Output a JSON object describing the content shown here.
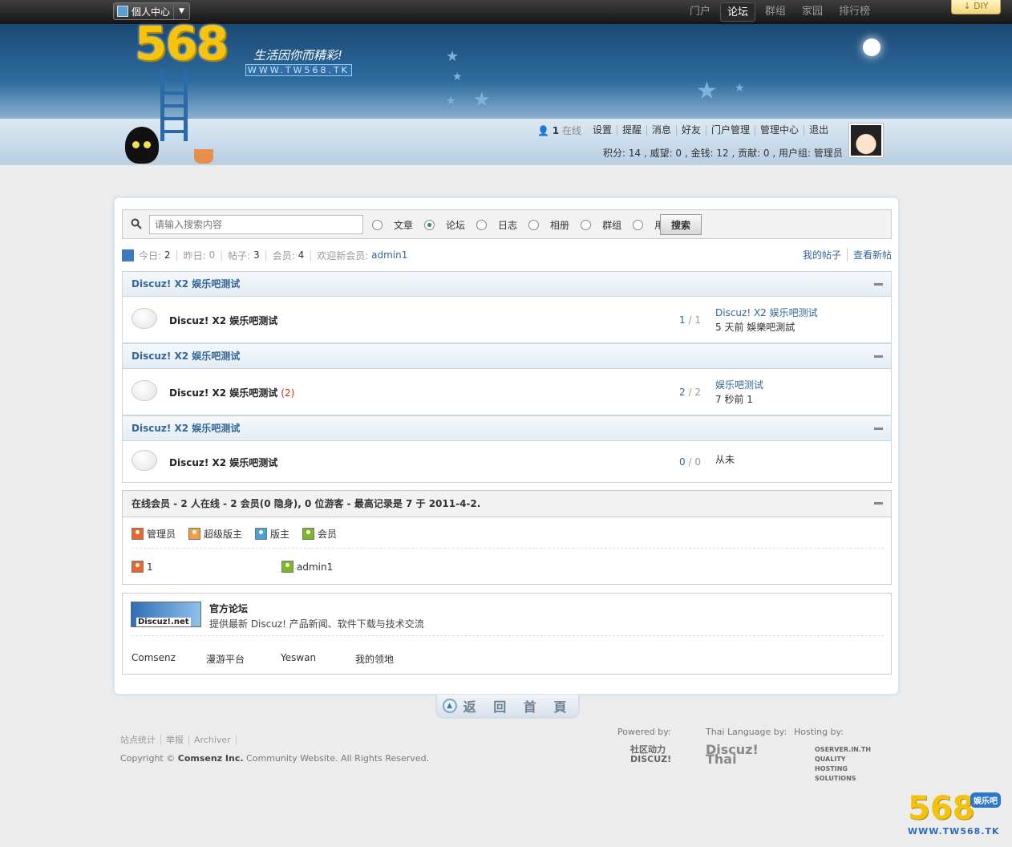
{
  "topbar": {
    "personal_label": "個人中心",
    "nav": [
      {
        "label": "门户",
        "active": false
      },
      {
        "label": "论坛",
        "active": true
      },
      {
        "label": "群组",
        "active": false
      },
      {
        "label": "家园",
        "active": false
      },
      {
        "label": "排行榜",
        "active": false
      }
    ],
    "diy_label": "DIY"
  },
  "header": {
    "logo_text": "568",
    "slogan": "生活因你而精彩!",
    "site_url": "WWW.TW568.TK"
  },
  "user": {
    "online_count": "1",
    "online_label": "在线",
    "menu": [
      "设置",
      "提醒",
      "消息",
      "好友",
      "门户管理",
      "管理中心",
      "退出"
    ],
    "credits": "积分: 14 , 威望: 0 , 金钱: 12 , 贡献: 0 , 用户组: 管理员"
  },
  "search": {
    "placeholder": "请输入搜索内容",
    "options": [
      {
        "label": "文章",
        "checked": false
      },
      {
        "label": "论坛",
        "checked": true
      },
      {
        "label": "日志",
        "checked": false
      },
      {
        "label": "相册",
        "checked": false
      },
      {
        "label": "群组",
        "checked": false
      },
      {
        "label": "用户",
        "checked": false
      }
    ],
    "button_label": "搜索"
  },
  "stats": {
    "today_label": "今日:",
    "today": "2",
    "yesterday_label": "昨日:",
    "yesterday": "0",
    "posts_label": "帖子:",
    "posts": "3",
    "members_label": "会员:",
    "members": "4",
    "newmember_label": "欢迎新会员:",
    "newmember": "admin1",
    "my_posts": "我的帖子",
    "new_posts": "查看新帖"
  },
  "categories": [
    {
      "title": "Discuz! X2 娱乐吧测试",
      "forum": {
        "name": "Discuz! X2 娱乐吧测试",
        "new_count": "",
        "threads": "1",
        "sep": "/",
        "posts": "1",
        "last_title": "Discuz! X2 娱乐吧测试",
        "last_meta": "5 天前  娛樂吧測試"
      }
    },
    {
      "title": "Discuz! X2 娱乐吧测试",
      "forum": {
        "name": "Discuz! X2 娱乐吧测试",
        "new_count": "(2)",
        "threads": "2",
        "sep": "/",
        "posts": "2",
        "last_title": "娱乐吧测试",
        "last_meta": "7 秒前  1"
      }
    },
    {
      "title": "Discuz! X2 娱乐吧测试",
      "forum": {
        "name": "Discuz! X2 娱乐吧测试",
        "new_count": "",
        "threads": "0",
        "sep": "/",
        "posts": "0",
        "last_title": "",
        "last_meta": "从未"
      }
    }
  ],
  "online": {
    "title": "在线会员  - 2 人在线  - 2 会员(0 隐身), 0 位游客  - 最高记录是  7 于  2011-4-2.",
    "legend": [
      {
        "label": "管理员",
        "color": "#e8682a"
      },
      {
        "label": "超级版主",
        "color": "#f0a040"
      },
      {
        "label": "版主",
        "color": "#4aa0d8"
      },
      {
        "label": "会员",
        "color": "#7ab828"
      }
    ],
    "users": [
      {
        "name": "1",
        "color": "#e8682a"
      },
      {
        "name": "admin1",
        "color": "#7ab828"
      }
    ]
  },
  "links": {
    "logo_text": "Discuz!.net",
    "title": "官方论坛",
    "desc": "提供最新  Discuz! 产品新闻、软件下载与技术交流",
    "friends": [
      "Comsenz",
      "漫游平台",
      "Yeswan",
      "我的领地"
    ]
  },
  "back_home": "返 回 首 頁",
  "footer": {
    "links": [
      "站点统计",
      "举报",
      "Archiver"
    ],
    "copyright_prefix": "Copyright ©",
    "company": "Comsenz Inc.",
    "copyright_suffix": " Community Website. All Rights Reserved.",
    "powered_label": "Powered by:",
    "powered_logo": "社区动力 DISCUZ!",
    "thai_label": "Thai Language by:",
    "thai_logo": "Discuz! Thai",
    "hosting_label": "Hosting by:",
    "hosting_logo": "OSERVER.IN.TH QUALITY HOSTING SOLUTIONS"
  },
  "watermark": {
    "number": "568",
    "tag": "娱乐吧",
    "url": "WWW.TW568.TK"
  }
}
